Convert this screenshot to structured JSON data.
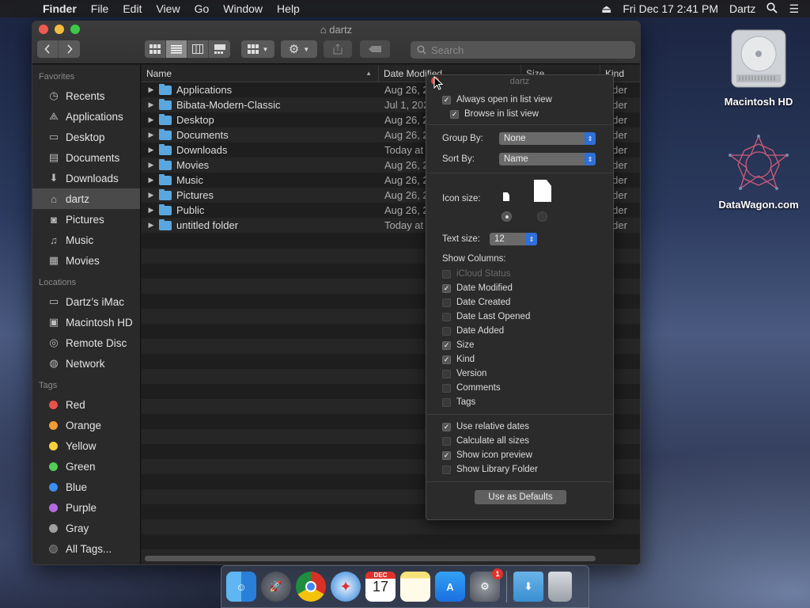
{
  "menubar": {
    "app": "Finder",
    "items": [
      "File",
      "Edit",
      "View",
      "Go",
      "Window",
      "Help"
    ],
    "datetime": "Fri Dec 17  2:41 PM",
    "user": "Dartz"
  },
  "window": {
    "title": "dartz",
    "search_placeholder": "Search"
  },
  "sidebar": {
    "favorites_header": "Favorites",
    "favorites": [
      {
        "label": "Recents",
        "icon": "clock-icon"
      },
      {
        "label": "Applications",
        "icon": "applications-icon"
      },
      {
        "label": "Desktop",
        "icon": "desktop-icon"
      },
      {
        "label": "Documents",
        "icon": "document-icon"
      },
      {
        "label": "Downloads",
        "icon": "download-icon"
      },
      {
        "label": "dartz",
        "icon": "home-icon"
      },
      {
        "label": "Pictures",
        "icon": "camera-icon"
      },
      {
        "label": "Music",
        "icon": "music-icon"
      },
      {
        "label": "Movies",
        "icon": "film-icon"
      }
    ],
    "locations_header": "Locations",
    "locations": [
      {
        "label": "Dartz’s iMac",
        "icon": "imac-icon"
      },
      {
        "label": "Macintosh HD",
        "icon": "disk-icon"
      },
      {
        "label": "Remote Disc",
        "icon": "disc-icon"
      },
      {
        "label": "Network",
        "icon": "globe-icon"
      }
    ],
    "tags_header": "Tags",
    "tags": [
      {
        "label": "Red",
        "color": "#e8524a"
      },
      {
        "label": "Orange",
        "color": "#f39b34"
      },
      {
        "label": "Yellow",
        "color": "#f5d33a"
      },
      {
        "label": "Green",
        "color": "#4fcf57"
      },
      {
        "label": "Blue",
        "color": "#3a8ff0"
      },
      {
        "label": "Purple",
        "color": "#b46ae0"
      },
      {
        "label": "Gray",
        "color": "#a0a0a0"
      },
      {
        "label": "All Tags...",
        "color": "#555555"
      }
    ]
  },
  "columns": {
    "name": "Name",
    "date": "Date Modified",
    "size": "Size",
    "kind": "Kind"
  },
  "files": [
    {
      "name": "Applications",
      "date": "Aug 26, 2",
      "kind": "older"
    },
    {
      "name": "Bibata-Modern-Classic",
      "date": "Jul 1, 202",
      "kind": "older"
    },
    {
      "name": "Desktop",
      "date": "Aug 26, 2",
      "kind": "older"
    },
    {
      "name": "Documents",
      "date": "Aug 26, 2",
      "kind": "older"
    },
    {
      "name": "Downloads",
      "date": "Today at",
      "kind": "older"
    },
    {
      "name": "Movies",
      "date": "Aug 26, 2",
      "kind": "older"
    },
    {
      "name": "Music",
      "date": "Aug 26, 2",
      "kind": "older"
    },
    {
      "name": "Pictures",
      "date": "Aug 26, 2",
      "kind": "older"
    },
    {
      "name": "Public",
      "date": "Aug 26, 2",
      "kind": "older"
    },
    {
      "name": "untitled folder",
      "date": "Today at",
      "kind": "older"
    }
  ],
  "view_options": {
    "title": "dartz",
    "always_open_list": "Always open in list view",
    "browse_list": "Browse in list view",
    "group_by_label": "Group By:",
    "group_by_value": "None",
    "sort_by_label": "Sort By:",
    "sort_by_value": "Name",
    "icon_size_label": "Icon size:",
    "text_size_label": "Text size:",
    "text_size_value": "12",
    "show_columns_label": "Show Columns:",
    "columns": [
      {
        "label": "iCloud Status",
        "checked": false,
        "disabled": true
      },
      {
        "label": "Date Modified",
        "checked": true
      },
      {
        "label": "Date Created",
        "checked": false
      },
      {
        "label": "Date Last Opened",
        "checked": false
      },
      {
        "label": "Date Added",
        "checked": false
      },
      {
        "label": "Size",
        "checked": true
      },
      {
        "label": "Kind",
        "checked": true
      },
      {
        "label": "Version",
        "checked": false
      },
      {
        "label": "Comments",
        "checked": false
      },
      {
        "label": "Tags",
        "checked": false
      }
    ],
    "options": [
      {
        "label": "Use relative dates",
        "checked": true
      },
      {
        "label": "Calculate all sizes",
        "checked": false
      },
      {
        "label": "Show icon preview",
        "checked": true
      },
      {
        "label": "Show Library Folder",
        "checked": false
      }
    ],
    "defaults_button": "Use as Defaults"
  },
  "desktop": {
    "hd_label": "Macintosh HD",
    "datawagon_label": "DataWagon.com"
  },
  "dock": {
    "calendar_month": "DEC",
    "calendar_day": "17",
    "badge": "1"
  }
}
